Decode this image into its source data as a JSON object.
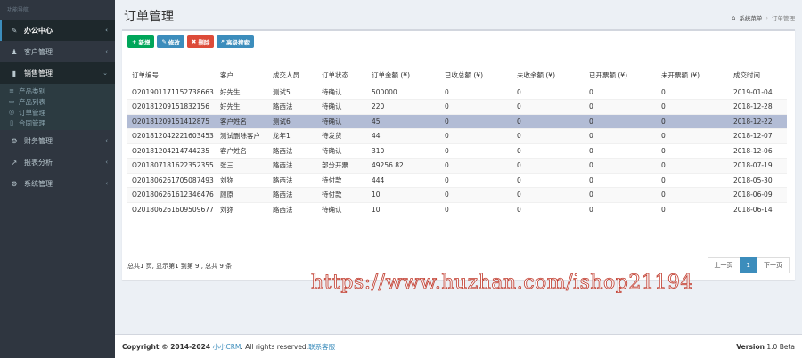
{
  "sidebar": {
    "header": "功能导航",
    "items": [
      {
        "icon": "briefcase-icon",
        "glyph": "✎",
        "label": "办公中心"
      },
      {
        "icon": "user-icon",
        "glyph": "♟",
        "label": "客户管理"
      },
      {
        "icon": "bar-chart-icon",
        "glyph": "▮",
        "label": "销售管理"
      },
      {
        "icon": "gear-icon",
        "glyph": "⚙",
        "label": "财务管理"
      },
      {
        "icon": "line-chart-icon",
        "glyph": "↗",
        "label": "报表分析"
      },
      {
        "icon": "cog-icon",
        "glyph": "⚙",
        "label": "系统管理"
      }
    ],
    "sub_items": [
      {
        "glyph": "≡",
        "label": "产品类别"
      },
      {
        "glyph": "▭",
        "label": "产品列表"
      },
      {
        "glyph": "◎",
        "label": "订单管理"
      },
      {
        "glyph": "▯",
        "label": "合同管理"
      }
    ]
  },
  "header": {
    "title": "订单管理",
    "breadcrumb_home": "系统菜单",
    "breadcrumb_current": "订单管理"
  },
  "toolbar": {
    "add_label": "新增",
    "edit_label": "修改",
    "delete_label": "删除",
    "search_label": "高级搜索"
  },
  "table": {
    "headers": [
      "订单编号",
      "客户",
      "成交人员",
      "订单状态",
      "订单金额 (¥)",
      "已收总额 (¥)",
      "未收余额 (¥)",
      "已开票额 (¥)",
      "未开票额 (¥)",
      "成交时间"
    ],
    "rows": [
      [
        "O201901171152738663",
        "好先生",
        "测试5",
        "待确认",
        "500000",
        "0",
        "0",
        "0",
        "0",
        "2019-01-04"
      ],
      [
        "O20181209151832156",
        "好先生",
        "路西法",
        "待确认",
        "220",
        "0",
        "0",
        "0",
        "0",
        "2018-12-28"
      ],
      [
        "O20181209151412875",
        "客户姓名",
        "测试6",
        "待确认",
        "45",
        "0",
        "0",
        "0",
        "0",
        "2018-12-22"
      ],
      [
        "O201812042221603453",
        "测试删除客户",
        "龙年1",
        "待发货",
        "44",
        "0",
        "0",
        "0",
        "0",
        "2018-12-07"
      ],
      [
        "O20181204214744235",
        "客户姓名",
        "路西法",
        "待确认",
        "310",
        "0",
        "0",
        "0",
        "0",
        "2018-12-06"
      ],
      [
        "O201807181622352355",
        "张三",
        "路西法",
        "部分开票",
        "49256.82",
        "0",
        "0",
        "0",
        "0",
        "2018-07-19"
      ],
      [
        "O201806261705087493",
        "刘狝",
        "路西法",
        "待付款",
        "444",
        "0",
        "0",
        "0",
        "0",
        "2018-05-30"
      ],
      [
        "O201806261612346476",
        "顾原",
        "路西法",
        "待付款",
        "10",
        "0",
        "0",
        "0",
        "0",
        "2018-06-09"
      ],
      [
        "O201806261609509677",
        "刘狝",
        "路西法",
        "待确认",
        "10",
        "0",
        "0",
        "0",
        "0",
        "2018-06-14"
      ]
    ],
    "selected_row": 2
  },
  "pagination": {
    "summary": "总共1 页, 显示第1 到第 9 , 总共 9 条",
    "prev": "上一页",
    "current": "1",
    "next": "下一页"
  },
  "watermark": "https://www.huzhan.com/ishop21194",
  "footer": {
    "copyright": "Copyright © 2014-2024",
    "brand": "小小CRM",
    "reserved": ". All rights reserved.",
    "contact": "联系客服",
    "version_label": "Version",
    "version": "1.0 Beta"
  }
}
